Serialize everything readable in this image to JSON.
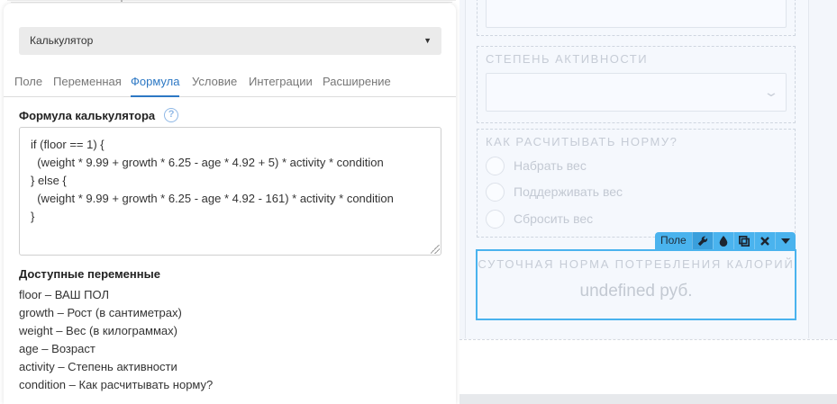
{
  "settings": {
    "field_type": "Калькулятор",
    "tabs": [
      {
        "label": "Поле"
      },
      {
        "label": "Переменная"
      },
      {
        "label": "Формула"
      },
      {
        "label": "Условие"
      },
      {
        "label": "Интеграции"
      },
      {
        "label": "Расширение"
      }
    ],
    "active_tab": "Формула",
    "formula_title": "Формула калькулятора",
    "help_glyph": "?",
    "formula": "if (floor == 1) {\n  (weight * 9.99 + growth * 6.25 - age * 4.92 + 5) * activity * condition\n} else {\n  (weight * 9.99 + growth * 6.25 - age * 4.92 - 161) * activity * condition\n}",
    "vars_title": "Доступные переменные",
    "variables": [
      "floor – ВАШ ПОЛ",
      "growth – Рост (в сантиметрах)",
      "weight – Вес (в килограммах)",
      "age – Возраст",
      "activity – Степень активности",
      "condition – Как расчитывать норму?"
    ]
  },
  "preview": {
    "activity_label": "Степень активности",
    "norm_label": "Как расчитывать норму?",
    "norm_options": [
      "Набрать вес",
      "Поддерживать вес",
      "Сбросить вес"
    ],
    "toolbar": {
      "label": "Поле",
      "icons": [
        "wrench-icon",
        "drop-icon",
        "copy-icon",
        "close-icon",
        "chevron-down-icon"
      ]
    },
    "selected_field_title": "Суточная норма потребления калорий",
    "selected_field_value": "undefined руб."
  },
  "colors": {
    "accent": "#2d78c4",
    "selection": "#4ab3ee",
    "preview_bg": "#f3f6fb"
  }
}
